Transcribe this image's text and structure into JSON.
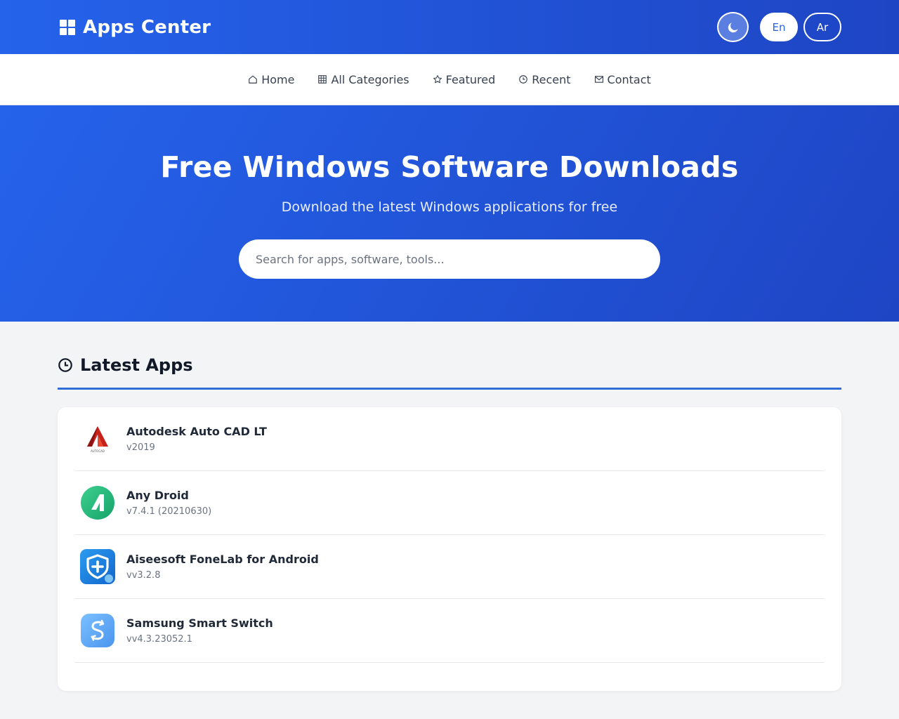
{
  "header": {
    "title": "Apps Center",
    "lang_en": "En",
    "lang_ar": "Ar"
  },
  "nav": [
    {
      "label": "Home",
      "icon": "home-icon"
    },
    {
      "label": "All Categories",
      "icon": "grid-icon"
    },
    {
      "label": "Featured",
      "icon": "star-icon"
    },
    {
      "label": "Recent",
      "icon": "clock-icon"
    },
    {
      "label": "Contact",
      "icon": "mail-icon"
    }
  ],
  "hero": {
    "title": "Free Windows Software Downloads",
    "subtitle": "Download the latest Windows applications for free",
    "search_placeholder": "Search for apps, software, tools..."
  },
  "latest": {
    "title": "Latest Apps",
    "apps": [
      {
        "name": "Autodesk Auto CAD LT",
        "version": "v2019",
        "icon": "autocad-icon",
        "icon_caption": "AUTOCAD"
      },
      {
        "name": "Any Droid",
        "version": "v7.4.1 (20210630)",
        "icon": "anydroid-icon"
      },
      {
        "name": "Aiseesoft FoneLab for Android",
        "version": "vv3.2.8",
        "icon": "fonelab-icon"
      },
      {
        "name": "Samsung Smart Switch",
        "version": "vv4.3.23052.1",
        "icon": "smart-switch-icon"
      }
    ]
  },
  "colors": {
    "primary": "#2563eb",
    "primary_dark": "#1e45c4",
    "accent_line": "#2f6fd6"
  }
}
